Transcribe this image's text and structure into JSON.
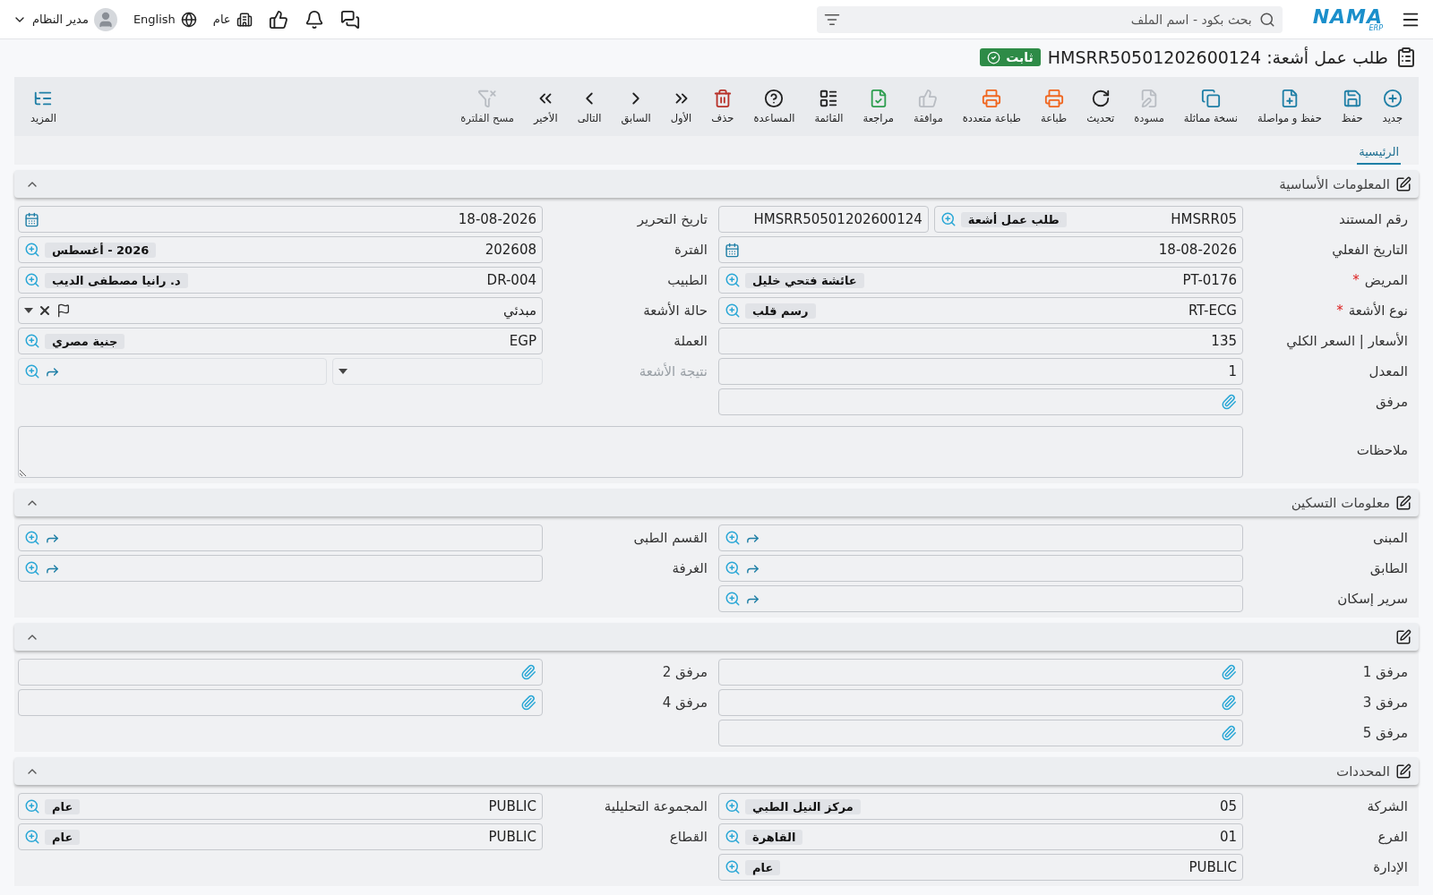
{
  "topbar": {
    "logo": "NAMA",
    "logo_sub": "ERP",
    "search": {
      "placeholder": "بحث بكود - اسم الملف"
    },
    "company": "عام",
    "language": "English",
    "user": "مدير النظام"
  },
  "document": {
    "title": "طلب عمل أشعة: HMSRR50501202600124",
    "status": "ثابت"
  },
  "toolbar": [
    {
      "kind": "new",
      "label": "جديد",
      "disabled": false
    },
    {
      "kind": "save",
      "label": "حفظ",
      "disabled": false
    },
    {
      "kind": "save_continue",
      "label": "حفظ و مواصلة",
      "disabled": false
    },
    {
      "kind": "duplicate",
      "label": "نسخة مماثلة",
      "disabled": false
    },
    {
      "kind": "draft",
      "label": "مسودة",
      "disabled": true
    },
    {
      "kind": "refresh",
      "label": "تحديث",
      "disabled": false
    },
    {
      "kind": "print",
      "label": "طباعة",
      "disabled": false
    },
    {
      "kind": "multi_print",
      "label": "طباعة متعددة",
      "disabled": false
    },
    {
      "kind": "approve",
      "label": "موافقة",
      "disabled": true
    },
    {
      "kind": "review",
      "label": "مراجعة",
      "disabled": false
    },
    {
      "kind": "list",
      "label": "القائمة",
      "disabled": false
    },
    {
      "kind": "help",
      "label": "المساعدة",
      "disabled": false
    },
    {
      "kind": "delete",
      "label": "حذف",
      "disabled": false
    },
    {
      "kind": "first",
      "label": "الأول",
      "disabled": false
    },
    {
      "kind": "previous",
      "label": "السابق",
      "disabled": false
    },
    {
      "kind": "next",
      "label": "التالى",
      "disabled": false
    },
    {
      "kind": "last",
      "label": "الأخير",
      "disabled": false
    },
    {
      "kind": "clear_filter",
      "label": "مسح الفلترة",
      "disabled": true
    }
  ],
  "more": "المزيد",
  "required_marker": "*",
  "tabs": [
    {
      "label": "الرئيسية",
      "selected": true
    }
  ],
  "sections": [
    {
      "title": "المعلومات الأساسية",
      "expanded": true,
      "columns": [
        [
          {
            "kind": "doc_number",
            "label": "رقم المستند",
            "required": false,
            "value": "HMSRR05",
            "tag": "طلب عمل أشعة",
            "serial": "HMSRR50501202600124"
          },
          {
            "kind": "date",
            "label": "التاريخ الفعلي",
            "required": false,
            "value": "18-08-2026"
          },
          {
            "kind": "lookup",
            "label": "المريض",
            "required": true,
            "value": "PT-0176",
            "tag": "عائشة فتحي خليل"
          },
          {
            "kind": "lookup",
            "label": "نوع الأشعة",
            "required": true,
            "value": "RT-ECG",
            "tag": "رسم قلب"
          },
          {
            "kind": "text",
            "label": "الأسعار | السعر الكلي",
            "required": false,
            "value": "135"
          },
          {
            "kind": "text",
            "label": "المعدل",
            "required": false,
            "value": "1"
          },
          {
            "kind": "attach",
            "label": "مرفق",
            "required": false
          }
        ],
        [
          {
            "kind": "date",
            "label": "تاريخ التحرير",
            "required": false,
            "value": "18-08-2026"
          },
          {
            "kind": "lookup",
            "label": "الفترة",
            "required": false,
            "value": "202608",
            "tag": "2026 - أغسطس"
          },
          {
            "kind": "lookup",
            "label": "الطبيب",
            "required": false,
            "value": "DR-004",
            "tag": "د. رانيا مصطفى الديب"
          },
          {
            "kind": "status",
            "label": "حالة الأشعة",
            "required": false,
            "value": "مبدئي"
          },
          {
            "kind": "lookup",
            "label": "العملة",
            "required": false,
            "value": "EGP",
            "tag": "جنية مصري"
          },
          {
            "kind": "result",
            "label": "نتيجة الأشعة",
            "required": false
          }
        ]
      ],
      "notes": {
        "label": "ملاحظات"
      }
    },
    {
      "title": "معلومات التسكين",
      "expanded": true,
      "columns": [
        [
          {
            "kind": "link",
            "label": "المبنى",
            "required": false
          },
          {
            "kind": "link",
            "label": "الطابق",
            "required": false
          },
          {
            "kind": "link",
            "label": "سرير إسكان",
            "required": false
          }
        ],
        [
          {
            "kind": "link",
            "label": "القسم الطبى",
            "required": false
          },
          {
            "kind": "link",
            "label": "الغرفة",
            "required": false
          }
        ]
      ]
    },
    {
      "expanded": true,
      "columns": [
        [
          {
            "kind": "attach",
            "label": "مرفق 1",
            "required": false
          },
          {
            "kind": "attach",
            "label": "مرفق 3",
            "required": false
          },
          {
            "kind": "attach",
            "label": "مرفق 5",
            "required": false
          }
        ],
        [
          {
            "kind": "attach",
            "label": "مرفق 2",
            "required": false
          },
          {
            "kind": "attach",
            "label": "مرفق 4",
            "required": false
          }
        ]
      ]
    },
    {
      "title": "المحددات",
      "expanded": true,
      "columns": [
        [
          {
            "kind": "lookup",
            "label": "الشركة",
            "required": false,
            "value": "05",
            "tag": "مركز النيل الطبي"
          },
          {
            "kind": "lookup",
            "label": "الفرع",
            "required": false,
            "value": "01",
            "tag": "القاهرة"
          },
          {
            "kind": "lookup",
            "label": "الإدارة",
            "required": false,
            "value": "PUBLIC",
            "tag": "عام"
          }
        ],
        [
          {
            "kind": "lookup",
            "label": "المجموعة التحليلية",
            "required": false,
            "value": "PUBLIC",
            "tag": "عام"
          },
          {
            "kind": "lookup",
            "label": "القطاع",
            "required": false,
            "value": "PUBLIC",
            "tag": "عام"
          }
        ]
      ]
    }
  ]
}
